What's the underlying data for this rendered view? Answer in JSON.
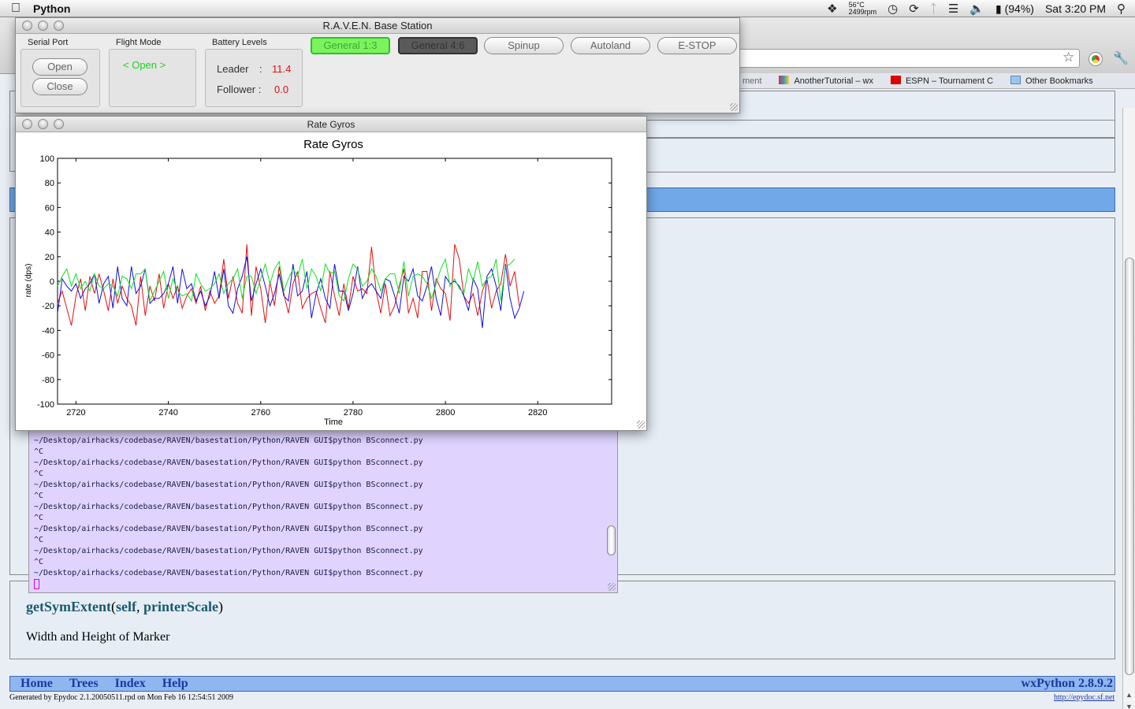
{
  "menubar": {
    "app_name": "Python",
    "temperature": "56°C",
    "fan": "2499rpm",
    "battery": "(94%)",
    "clock": "Sat 3:20 PM"
  },
  "browser": {
    "bookmarks": [
      {
        "label": "ment"
      },
      {
        "label": "AnotherTutorial – wx"
      },
      {
        "label": "ESPN – Tournament C"
      },
      {
        "label": "Other Bookmarks"
      }
    ],
    "method_name": "getSymExtent",
    "method_open": "(",
    "method_arg1": "self",
    "method_sep": ", ",
    "method_arg2": "printerScale",
    "method_close": ")",
    "method_desc": "Width and Height of Marker",
    "nav": {
      "home": "Home",
      "trees": "Trees",
      "index": "Index",
      "help": "Help",
      "version": "wxPython 2.8.9.2"
    },
    "generated": "Generated by Epydoc 2.1.20050511.rpd on Mon Feb 16 12:54:51 2009",
    "epydoc_link": "http://epydoc.sf.net"
  },
  "terminal": {
    "lines": "~/Desktop/airhacks/codebase/RAVEN/basestation/Python/RAVEN GUI$python BSconnect.py\n^C\n~/Desktop/airhacks/codebase/RAVEN/basestation/Python/RAVEN GUI$python BSconnect.py\n^C\n~/Desktop/airhacks/codebase/RAVEN/basestation/Python/RAVEN GUI$python BSconnect.py\n^C\n~/Desktop/airhacks/codebase/RAVEN/basestation/Python/RAVEN GUI$python BSconnect.py\n^C\n~/Desktop/airhacks/codebase/RAVEN/basestation/Python/RAVEN GUI$python BSconnect.py\n^C\n~/Desktop/airhacks/codebase/RAVEN/basestation/Python/RAVEN GUI$python BSconnect.py\n^C\n~/Desktop/airhacks/codebase/RAVEN/basestation/Python/RAVEN GUI$python BSconnect.py"
  },
  "raven": {
    "title": "R.A.V.E.N. Base Station",
    "serial_port_label": "Serial Port",
    "open_button": "Open",
    "close_button": "Close",
    "flight_mode_label": "Flight Mode",
    "flight_mode_value": "< Open >",
    "battery_label": "Battery Levels",
    "leader_label": "Leader",
    "leader_sep": ":",
    "leader_value": "11.4",
    "follower_label": "Follower :",
    "follower_value": "0.0",
    "general1_button": "General 1:3",
    "general2_button": "General 4:6",
    "spinup_button": "Spinup",
    "autoland_button": "Autoland",
    "estop_button": "E-STOP",
    "active_color": "#7cf35a",
    "value_color": "#e01010"
  },
  "gyros": {
    "window_title": "Rate Gyros"
  },
  "chart_data": {
    "type": "line",
    "title": "Rate Gyros",
    "xlabel": "Time",
    "ylabel": "rate (dps)",
    "xlim": [
      2716,
      2836
    ],
    "ylim": [
      -100,
      100
    ],
    "xticks": [
      2720,
      2740,
      2760,
      2780,
      2800,
      2820
    ],
    "yticks": [
      100,
      80,
      60,
      40,
      20,
      0,
      -20,
      -40,
      -60,
      -80,
      -100
    ],
    "grid": false,
    "x_start": 2716,
    "x_step": 1,
    "series": [
      {
        "color": "#e01010",
        "values": [
          -18,
          -8,
          -22,
          -36,
          -12,
          2,
          -24,
          4,
          -10,
          6,
          -8,
          -24,
          2,
          -18,
          -4,
          -14,
          -20,
          -36,
          4,
          -28,
          -4,
          -16,
          6,
          -22,
          -2,
          -14,
          -4,
          -22,
          -12,
          -6,
          -18,
          -4,
          -24,
          -8,
          -18,
          -12,
          18,
          -14,
          4,
          -18,
          -26,
          30,
          -28,
          12,
          -6,
          -34,
          0,
          -20,
          12,
          -10,
          -26,
          -2,
          8,
          -22,
          -14,
          -10,
          -8,
          -22,
          -34,
          8,
          -12,
          -28,
          -2,
          -22,
          4,
          -8,
          -6,
          -10,
          28,
          -8,
          -26,
          -2,
          -28,
          -20,
          -4,
          10,
          -26,
          -14,
          -30,
          8,
          8,
          -24,
          2,
          -6,
          -10,
          -32,
          30,
          18,
          -12,
          -18,
          -10,
          -28,
          -8,
          2,
          -22,
          -8,
          -2,
          22,
          -4,
          8,
          -20
        ]
      },
      {
        "color": "#1010e0",
        "values": [
          -26,
          2,
          -4,
          -8,
          -2,
          -14,
          -6,
          -2,
          6,
          -18,
          -2,
          4,
          -22,
          12,
          -14,
          -20,
          12,
          -10,
          -4,
          10,
          -18,
          -14,
          -14,
          -10,
          -2,
          12,
          -18,
          10,
          -6,
          -2,
          -16,
          -8,
          -20,
          -12,
          8,
          -14,
          10,
          -20,
          -26,
          -6,
          4,
          20,
          -16,
          -2,
          10,
          -4,
          -20,
          -10,
          6,
          -12,
          -16,
          14,
          -12,
          -8,
          8,
          -30,
          -10,
          2,
          -14,
          -22,
          14,
          -8,
          -8,
          -24,
          -10,
          12,
          -14,
          -6,
          -2,
          -8,
          -14,
          2,
          0,
          -12,
          -26,
          4,
          0,
          10,
          -12,
          -16,
          -4,
          12,
          -14,
          -28,
          4,
          -2,
          0,
          -4,
          -12,
          -24,
          2,
          -6,
          -38,
          4,
          10,
          -4,
          -24,
          14,
          -14,
          -30,
          -22,
          -8
        ]
      },
      {
        "color": "#10e020",
        "values": [
          -4,
          4,
          10,
          -4,
          6,
          -6,
          0,
          -8,
          6,
          -4,
          -6,
          -2,
          -4,
          -12,
          4,
          2,
          -6,
          6,
          6,
          10,
          -16,
          -8,
          0,
          8,
          -14,
          2,
          -8,
          -12,
          -10,
          -16,
          6,
          -2,
          -8,
          -6,
          -2,
          6,
          -10,
          -2,
          2,
          10,
          -14,
          4,
          4,
          -10,
          2,
          14,
          -2,
          10,
          16,
          -8,
          2,
          10,
          4,
          18,
          -6,
          10,
          4,
          -8,
          14,
          6,
          8,
          -12,
          -16,
          2,
          14,
          10,
          -4,
          0,
          10,
          4,
          -8,
          2,
          6,
          6,
          -10,
          16,
          -12,
          4,
          6,
          4,
          -2,
          -14,
          -2,
          10,
          18,
          -4,
          2,
          -6,
          -10,
          10,
          0,
          16,
          -4,
          2,
          4,
          18,
          -16,
          12,
          14,
          18
        ]
      }
    ]
  }
}
